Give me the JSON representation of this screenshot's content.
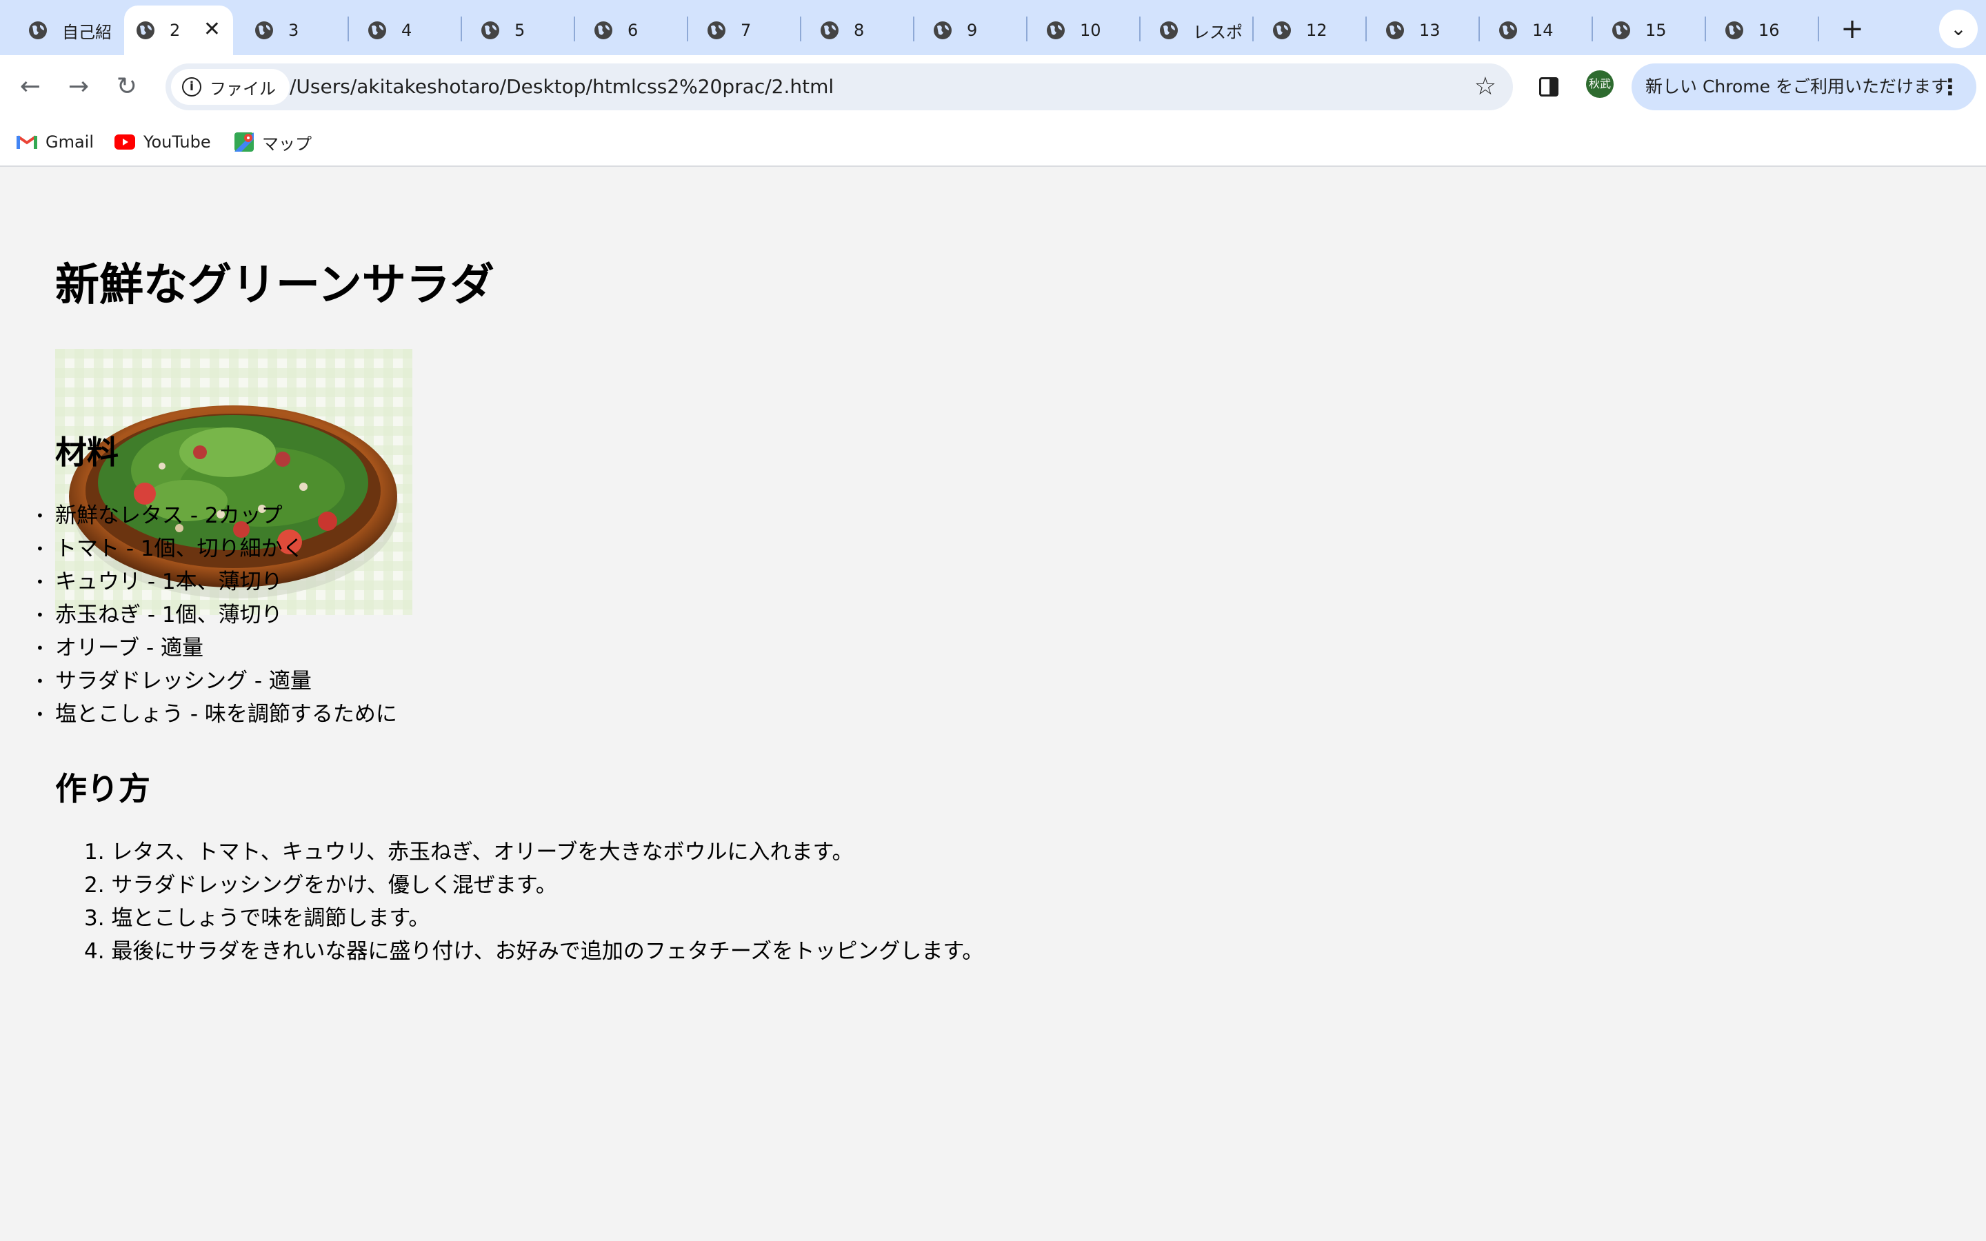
{
  "tabs": [
    {
      "label": "自己紹",
      "active": false
    },
    {
      "label": "2",
      "active": true
    },
    {
      "label": "3",
      "active": false
    },
    {
      "label": "4",
      "active": false
    },
    {
      "label": "5",
      "active": false
    },
    {
      "label": "6",
      "active": false
    },
    {
      "label": "7",
      "active": false
    },
    {
      "label": "8",
      "active": false
    },
    {
      "label": "9",
      "active": false
    },
    {
      "label": "10",
      "active": false
    },
    {
      "label": "レスポ",
      "active": false
    },
    {
      "label": "12",
      "active": false
    },
    {
      "label": "13",
      "active": false
    },
    {
      "label": "14",
      "active": false
    },
    {
      "label": "15",
      "active": false
    },
    {
      "label": "16",
      "active": false
    }
  ],
  "toolbar": {
    "chip_label": "ファイル",
    "url": "/Users/akitakeshotaro/Desktop/htmlcss2%20prac/2.html",
    "avatar_text": "秋武",
    "update_label": "新しい Chrome をご利用いただけます"
  },
  "bookmarks": [
    {
      "label": "Gmail",
      "icon": "gmail-icon"
    },
    {
      "label": "YouTube",
      "icon": "youtube-icon"
    },
    {
      "label": "マップ",
      "icon": "maps-icon"
    }
  ],
  "page": {
    "title": "新鮮なグリーンサラダ",
    "ingredients_heading": "材料",
    "ingredients": [
      "新鮮なレタス - 2カップ",
      "トマト - 1個、切り細かく",
      "キュウリ - 1本、薄切り",
      "赤玉ねぎ - 1個、薄切り",
      "オリーブ - 適量",
      "サラダドレッシング - 適量",
      "塩とこしょう - 味を調節するために"
    ],
    "steps_heading": "作り方",
    "steps": [
      "1. レタス、トマト、キュウリ、赤玉ねぎ、オリーブを大きなボウルに入れます。",
      "2. サラダドレッシングをかけ、優しく混ぜます。",
      "3. 塩とこしょうで味を調節します。",
      "4. 最後にサラダをきれいな器に盛り付け、お好みで追加のフェタチーズをトッピングします。"
    ]
  }
}
